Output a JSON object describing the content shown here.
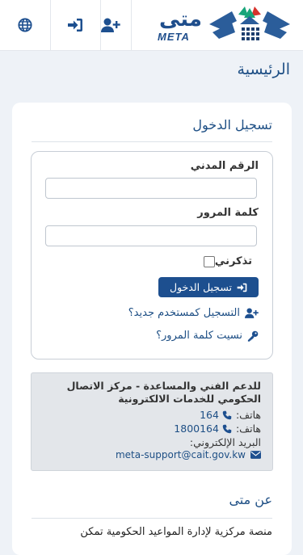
{
  "header": {
    "logo_ar": "متى",
    "logo_en": "META",
    "icons": [
      "globe-icon",
      "sign-in-icon",
      "user-plus-icon"
    ]
  },
  "page": {
    "title": "الرئيسية"
  },
  "login": {
    "title": "تسجيل الدخول",
    "civil_id_label": "الرقم المدني",
    "civil_id_value": "",
    "password_label": "كلمة المرور",
    "password_value": "",
    "remember_label": "تذكرني",
    "submit_label": "تسجيل الدخول",
    "register_link": "التسجيل كمستخدم جديد؟",
    "forgot_link": "نسيت كلمة المرور؟"
  },
  "support": {
    "title": "للدعم الفني والمساعدة - مركز الاتصال الحكومي للخدمات الالكترونية",
    "phone_label_1": "هاتف:",
    "phone_1": "164",
    "phone_label_2": "هاتف:",
    "phone_2": "1800164",
    "email_label": "البريد الإلكتروني:",
    "email": "meta-support@cait.gov.kw"
  },
  "about": {
    "title": "عن متى",
    "text": "منصة مركزية لإدارة المواعيد الحكومية تمكن"
  },
  "colors": {
    "primary": "#1d4f8f",
    "link": "#1e4f85",
    "background": "#eef2f7"
  }
}
